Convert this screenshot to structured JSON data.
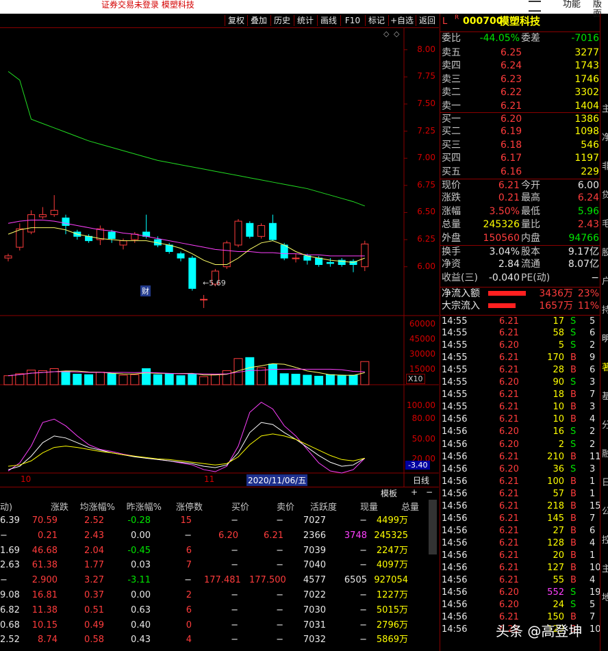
{
  "window": {
    "title": "证券交易未登录  模塑科技",
    "right_menu": [
      "功能",
      "版面"
    ]
  },
  "toolbar": {
    "buttons": [
      "复权",
      "叠加",
      "历史",
      "统计",
      "画线",
      "F10",
      "标记",
      "+自选",
      "返回"
    ]
  },
  "chart_data": [
    {
      "type": "candlestick",
      "title": "",
      "ylim": [
        5.55,
        8.2
      ],
      "yticks": [
        "8.00",
        "7.75",
        "7.50",
        "7.25",
        "7.00",
        "6.75",
        "6.50",
        "6.25",
        "6.00"
      ],
      "low_annotation": "5.69",
      "badge": "财",
      "candles": [
        {
          "o": 6.08,
          "c": 6.1,
          "h": 6.12,
          "l": 6.05
        },
        {
          "o": 6.18,
          "c": 6.35,
          "h": 6.4,
          "l": 6.15
        },
        {
          "o": 6.32,
          "c": 6.48,
          "h": 6.52,
          "l": 6.3
        },
        {
          "o": 6.46,
          "c": 6.48,
          "h": 6.55,
          "l": 6.44
        },
        {
          "o": 6.48,
          "c": 6.52,
          "h": 6.66,
          "l": 6.46
        },
        {
          "o": 6.45,
          "c": 6.38,
          "h": 6.48,
          "l": 6.3
        },
        {
          "o": 6.32,
          "c": 6.28,
          "h": 6.34,
          "l": 6.25
        },
        {
          "o": 6.28,
          "c": 6.24,
          "h": 6.3,
          "l": 6.22
        },
        {
          "o": 6.25,
          "c": 6.35,
          "h": 6.38,
          "l": 6.2
        },
        {
          "o": 6.32,
          "c": 6.26,
          "h": 6.34,
          "l": 6.22
        },
        {
          "o": 6.2,
          "c": 6.24,
          "h": 6.26,
          "l": 6.16
        },
        {
          "o": 6.25,
          "c": 6.3,
          "h": 6.32,
          "l": 6.22
        },
        {
          "o": 6.32,
          "c": 6.28,
          "h": 6.48,
          "l": 6.26
        },
        {
          "o": 6.25,
          "c": 6.2,
          "h": 6.28,
          "l": 6.18
        },
        {
          "o": 6.2,
          "c": 6.14,
          "h": 6.22,
          "l": 6.12
        },
        {
          "o": 6.12,
          "c": 6.08,
          "h": 6.14,
          "l": 6.05
        },
        {
          "o": 6.08,
          "c": 5.8,
          "h": 6.1,
          "l": 5.78
        },
        {
          "o": 5.7,
          "c": 5.7,
          "h": 5.74,
          "l": 5.62
        },
        {
          "o": 5.84,
          "c": 5.96,
          "h": 5.98,
          "l": 5.82
        },
        {
          "o": 6.0,
          "c": 6.22,
          "h": 6.24,
          "l": 5.98
        },
        {
          "o": 6.2,
          "c": 6.42,
          "h": 6.44,
          "l": 6.18
        },
        {
          "o": 6.4,
          "c": 6.28,
          "h": 6.42,
          "l": 6.26
        },
        {
          "o": 6.28,
          "c": 6.38,
          "h": 6.4,
          "l": 6.26
        },
        {
          "o": 6.4,
          "c": 6.25,
          "h": 6.48,
          "l": 6.24
        },
        {
          "o": 6.2,
          "c": 6.08,
          "h": 6.22,
          "l": 6.06
        },
        {
          "o": 6.08,
          "c": 6.08,
          "h": 6.12,
          "l": 6.04
        },
        {
          "o": 6.1,
          "c": 6.06,
          "h": 6.12,
          "l": 6.02
        },
        {
          "o": 6.08,
          "c": 6.02,
          "h": 6.1,
          "l": 6.0
        },
        {
          "o": 6.04,
          "c": 6.03,
          "h": 6.08,
          "l": 6.0
        },
        {
          "o": 6.06,
          "c": 6.02,
          "h": 6.08,
          "l": 6.0
        },
        {
          "o": 6.05,
          "c": 6.02,
          "h": 6.07,
          "l": 5.95
        },
        {
          "o": 6.0,
          "c": 6.21,
          "h": 6.24,
          "l": 5.96
        }
      ],
      "ma_green": [
        7.45,
        7.4,
        7.36,
        7.32,
        7.28,
        7.24,
        7.2,
        7.16,
        7.13,
        7.1,
        7.07,
        7.04,
        7.01,
        6.98,
        6.96,
        6.94,
        6.92,
        6.9,
        6.88,
        6.86,
        6.84,
        6.82,
        6.8,
        6.78,
        6.76,
        6.74,
        6.72,
        6.69,
        6.66,
        6.63,
        6.6,
        6.56
      ],
      "ma_magenta": [
        6.4,
        6.42,
        6.43,
        6.43,
        6.42,
        6.4,
        6.38,
        6.36,
        6.34,
        6.33,
        6.31,
        6.3,
        6.28,
        6.26,
        6.24,
        6.22,
        6.2,
        6.18,
        6.16,
        6.15,
        6.14,
        6.14,
        6.13,
        6.13,
        6.12,
        6.12,
        6.11,
        6.11,
        6.1,
        6.1,
        6.1,
        6.1
      ],
      "ma_yellow": [
        6.3,
        6.34,
        6.36,
        6.36,
        6.36,
        6.34,
        6.3,
        6.28,
        6.26,
        6.25,
        6.24,
        6.24,
        6.24,
        6.22,
        6.2,
        6.17,
        6.12,
        6.06,
        6.02,
        6.02,
        6.08,
        6.16,
        6.22,
        6.24,
        6.2,
        6.14,
        6.1,
        6.08,
        6.06,
        6.05,
        6.04,
        6.08
      ]
    },
    {
      "type": "bar",
      "title": "",
      "ylim": [
        0,
        68000
      ],
      "yticks": [
        "60000",
        "45000",
        "30000",
        "15000"
      ],
      "multiplier_label": "X10",
      "values": [
        9000,
        11000,
        14500,
        14000,
        16000,
        13000,
        10500,
        10000,
        12500,
        11000,
        9500,
        10000,
        16000,
        10000,
        10500,
        9000,
        11000,
        8000,
        10000,
        14000,
        26000,
        27000,
        17000,
        20500,
        11000,
        10500,
        9500,
        8500,
        10000,
        9000,
        9500,
        23000
      ],
      "up": [
        true,
        true,
        true,
        true,
        true,
        false,
        false,
        false,
        true,
        false,
        true,
        true,
        false,
        false,
        false,
        false,
        false,
        true,
        true,
        true,
        true,
        false,
        true,
        false,
        false,
        false,
        false,
        false,
        false,
        false,
        false,
        true
      ]
    },
    {
      "type": "line",
      "title": "",
      "ylim": [
        0,
        130
      ],
      "yticks": [
        "100.00",
        "80.00",
        "50.00",
        "20.00"
      ],
      "current_label": "-3.40",
      "series": [
        {
          "color": "#ff40ff",
          "values": [
            3,
            15,
            40,
            75,
            80,
            70,
            55,
            42,
            35,
            32,
            28,
            25,
            22,
            20,
            18,
            15,
            12,
            5,
            2,
            10,
            40,
            90,
            105,
            95,
            70,
            55,
            35,
            15,
            3,
            0,
            5,
            22
          ]
        },
        {
          "color": "#ffffff",
          "values": [
            5,
            10,
            25,
            45,
            55,
            52,
            45,
            38,
            34,
            30,
            27,
            24,
            22,
            20,
            18,
            16,
            14,
            10,
            8,
            12,
            30,
            60,
            75,
            72,
            60,
            50,
            38,
            26,
            16,
            10,
            12,
            22
          ]
        },
        {
          "color": "#ffff00",
          "values": [
            10,
            12,
            18,
            30,
            38,
            40,
            38,
            35,
            32,
            30,
            27,
            25,
            23,
            21,
            20,
            18,
            16,
            14,
            12,
            14,
            24,
            42,
            55,
            58,
            55,
            50,
            42,
            34,
            26,
            20,
            18,
            22
          ]
        }
      ]
    }
  ],
  "dates": {
    "x_label_1": "10",
    "x_label_2": "11",
    "cursor": "2020/11/06/五"
  },
  "bottom_tabs": {
    "tab1": "日线",
    "plus": "+",
    "minus": "−",
    "template": "模板"
  },
  "quote": {
    "code": "000700",
    "name": "模塑科技",
    "marker_l": "L",
    "marker_r": "R",
    "weibi_label": "委比",
    "weibi": "-44.05%",
    "weicha_label": "委差",
    "weicha": "-7016",
    "asks": [
      {
        "label": "卖五",
        "price": "6.25",
        "vol": "3277"
      },
      {
        "label": "卖四",
        "price": "6.24",
        "vol": "1743"
      },
      {
        "label": "卖三",
        "price": "6.23",
        "vol": "1746"
      },
      {
        "label": "卖二",
        "price": "6.22",
        "vol": "3302"
      },
      {
        "label": "卖一",
        "price": "6.21",
        "vol": "1404"
      }
    ],
    "bids": [
      {
        "label": "买一",
        "price": "6.20",
        "vol": "1386"
      },
      {
        "label": "买二",
        "price": "6.19",
        "vol": "1098"
      },
      {
        "label": "买三",
        "price": "6.18",
        "vol": "546"
      },
      {
        "label": "买四",
        "price": "6.17",
        "vol": "1197"
      },
      {
        "label": "买五",
        "price": "6.16",
        "vol": "229"
      }
    ],
    "stats": [
      {
        "l1": "现价",
        "v1": "6.21",
        "c1": "red",
        "l2": "今开",
        "v2": "6.00",
        "c2": "wht"
      },
      {
        "l1": "涨跌",
        "v1": "0.21",
        "c1": "red",
        "l2": "最高",
        "v2": "6.24",
        "c2": "red"
      },
      {
        "l1": "涨幅",
        "v1": "3.50%",
        "c1": "red",
        "l2": "最低",
        "v2": "5.96",
        "c2": "green"
      },
      {
        "l1": "总量",
        "v1": "245326",
        "c1": "yel",
        "l2": "量比",
        "v2": "2.43",
        "c2": "red"
      },
      {
        "l1": "外盘",
        "v1": "150560",
        "c1": "red",
        "l2": "内盘",
        "v2": "94766",
        "c2": "green"
      }
    ],
    "stats2": [
      {
        "l1": "换手",
        "v1": "3.04%",
        "l2": "股本",
        "v2": "9.17亿"
      },
      {
        "l1": "净资",
        "v1": "2.84",
        "l2": "流通",
        "v2": "8.07亿"
      },
      {
        "l1": "收益(三)",
        "v1": "-0.040",
        "l2": "PE(动)",
        "v2": "−"
      }
    ],
    "flows": [
      {
        "label": "净流入额",
        "value": "3436万",
        "pct": "23%"
      },
      {
        "label": "大宗流入",
        "value": "1657万",
        "pct": "11%"
      }
    ]
  },
  "ticks": [
    {
      "t": "14:55",
      "p": "6.21",
      "v": "17",
      "s": "S",
      "n": "5"
    },
    {
      "t": "14:55",
      "p": "6.21",
      "v": "58",
      "s": "S",
      "n": "6"
    },
    {
      "t": "14:55",
      "p": "6.20",
      "v": "5",
      "s": "S",
      "n": "2"
    },
    {
      "t": "14:55",
      "p": "6.21",
      "v": "170",
      "s": "B",
      "n": "9"
    },
    {
      "t": "14:55",
      "p": "6.21",
      "v": "28",
      "s": "B",
      "n": "6"
    },
    {
      "t": "14:55",
      "p": "6.20",
      "v": "90",
      "s": "S",
      "n": "3"
    },
    {
      "t": "14:55",
      "p": "6.21",
      "v": "18",
      "s": "B",
      "n": "7"
    },
    {
      "t": "14:55",
      "p": "6.21",
      "v": "10",
      "s": "B",
      "n": "3"
    },
    {
      "t": "14:56",
      "p": "6.21",
      "v": "10",
      "s": "B",
      "n": "4"
    },
    {
      "t": "14:56",
      "p": "6.20",
      "v": "16",
      "s": "S",
      "n": "2"
    },
    {
      "t": "14:56",
      "p": "6.20",
      "v": "2",
      "s": "S",
      "n": "2"
    },
    {
      "t": "14:56",
      "p": "6.21",
      "v": "210",
      "s": "B",
      "n": "11"
    },
    {
      "t": "14:56",
      "p": "6.20",
      "v": "36",
      "s": "S",
      "n": "3"
    },
    {
      "t": "14:56",
      "p": "6.21",
      "v": "100",
      "s": "B",
      "n": "1"
    },
    {
      "t": "14:56",
      "p": "6.21",
      "v": "57",
      "s": "B",
      "n": "1"
    },
    {
      "t": "14:56",
      "p": "6.21",
      "v": "218",
      "s": "B",
      "n": "15"
    },
    {
      "t": "14:56",
      "p": "6.21",
      "v": "145",
      "s": "B",
      "n": "7"
    },
    {
      "t": "14:56",
      "p": "6.21",
      "v": "27",
      "s": "B",
      "n": "6"
    },
    {
      "t": "14:56",
      "p": "6.21",
      "v": "128",
      "s": "B",
      "n": "4"
    },
    {
      "t": "14:56",
      "p": "6.21",
      "v": "20",
      "s": "B",
      "n": "1"
    },
    {
      "t": "14:56",
      "p": "6.21",
      "v": "127",
      "s": "B",
      "n": "10"
    },
    {
      "t": "14:56",
      "p": "6.21",
      "v": "55",
      "s": "B",
      "n": "4"
    },
    {
      "t": "14:56",
      "p": "6.20",
      "v": "552",
      "s": "S",
      "n": "19"
    },
    {
      "t": "14:56",
      "p": "6.20",
      "v": "24",
      "s": "S",
      "n": "5"
    },
    {
      "t": "14:56",
      "p": "6.21",
      "v": "150",
      "s": "B",
      "n": "7"
    },
    {
      "t": "14:56",
      "p": "6.21",
      "v": "129",
      "s": "B",
      "n": "10"
    }
  ],
  "edge_strip": [
    "主",
    "净",
    "非",
    "贷",
    "毛",
    "股",
    "户",
    "持",
    "明",
    "著",
    "基",
    "分",
    "融",
    "日",
    "公",
    "控",
    "主",
    "地"
  ],
  "table": {
    "headers": [
      "动)",
      "涨跌",
      "均涨幅%",
      "昨涨幅%",
      "涨停数",
      "买价",
      "卖价",
      "活跃度",
      "现量",
      "总量"
    ],
    "rows": [
      [
        "6.39",
        "70.59",
        "2.52",
        "-0.28",
        "15",
        "−",
        "−",
        "7027",
        "−",
        "4499万"
      ],
      [
        "−",
        "0.21",
        "2.43",
        "0.00",
        "−",
        "6.20",
        "6.21",
        "2366",
        "3748",
        "245325"
      ],
      [
        "1.69",
        "46.68",
        "2.04",
        "-0.45",
        "6",
        "−",
        "−",
        "7039",
        "−",
        "2247万"
      ],
      [
        "2.63",
        "61.38",
        "1.77",
        "0.03",
        "7",
        "−",
        "−",
        "7040",
        "−",
        "4097万"
      ],
      [
        "−",
        "2.900",
        "3.27",
        "-3.11",
        "−",
        "177.481",
        "177.500",
        "4577",
        "6505",
        "927054"
      ],
      [
        "9.08",
        "16.81",
        "0.37",
        "0.00",
        "2",
        "−",
        "−",
        "7022",
        "−",
        "1227万"
      ],
      [
        "6.82",
        "11.38",
        "0.51",
        "0.63",
        "6",
        "−",
        "−",
        "7030",
        "−",
        "5015万"
      ],
      [
        "0.68",
        "10.15",
        "0.49",
        "0.40",
        "0",
        "−",
        "−",
        "7031",
        "−",
        "2796万"
      ],
      [
        "2.52",
        "8.74",
        "0.58",
        "0.43",
        "4",
        "−",
        "−",
        "7032",
        "−",
        "5869万"
      ]
    ]
  },
  "watermark": "头条 @高登坤"
}
